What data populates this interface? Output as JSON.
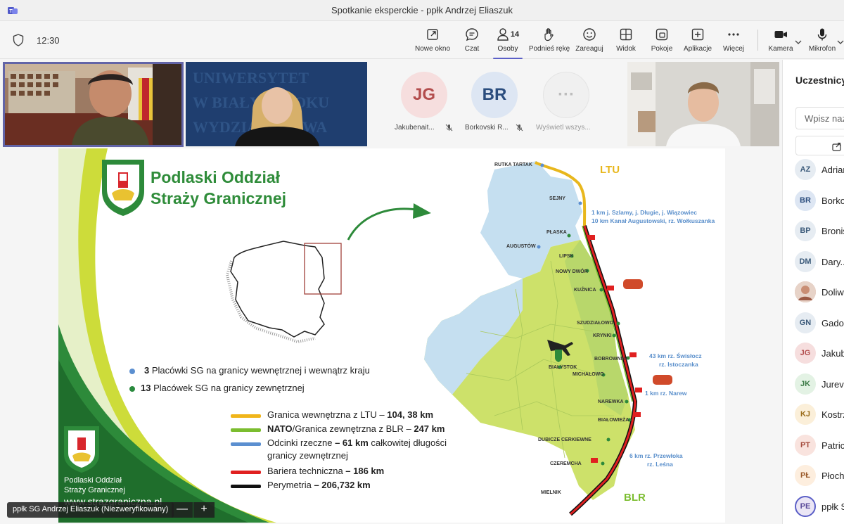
{
  "window": {
    "title": "Spotkanie eksperckie - ppłk Andrzej Eliaszuk"
  },
  "toolbar": {
    "time": "12:30",
    "buttons": [
      {
        "label": "Nowe okno",
        "icon": "pop-out-icon"
      },
      {
        "label": "Czat",
        "icon": "chat-icon"
      },
      {
        "label": "Osoby",
        "icon": "people-icon",
        "count": "14",
        "active": true
      },
      {
        "label": "Podnieś rękę",
        "icon": "raise-hand-icon"
      },
      {
        "label": "Zareaguj",
        "icon": "smiley-icon"
      },
      {
        "label": "Widok",
        "icon": "grid-view-icon"
      },
      {
        "label": "Pokoje",
        "icon": "breakout-rooms-icon"
      },
      {
        "label": "Aplikacje",
        "icon": "add-apps-icon"
      },
      {
        "label": "Więcej",
        "icon": "more-icon"
      },
      {
        "label": "Kamera",
        "icon": "camera-icon"
      },
      {
        "label": "Mikrofon",
        "icon": "microphone-icon"
      }
    ]
  },
  "participants_strip": [
    {
      "initials": "JG",
      "name": "Jakubenait...",
      "bg": "#f6dede",
      "fg": "#b34d4d",
      "muted": true
    },
    {
      "initials": "BR",
      "name": "Borkovski R...",
      "bg": "#dde6f3",
      "fg": "#2b4d7e",
      "muted": true
    },
    {
      "initials": "···",
      "name": "Wyświetl wszys...",
      "bg": "#f0f0f0",
      "fg": "#bdbdbd",
      "muted": false
    }
  ],
  "slide": {
    "title_line1": "Podlaski Oddział",
    "title_line2": "Straży Granicznej",
    "bullets": [
      {
        "num": "3",
        "text": "Placówki SG na granicy wewnętrznej i wewnątrz kraju",
        "color": "#5b8fd0"
      },
      {
        "num": "13",
        "text": "Placówek SG na granicy zewnętrznej",
        "color": "#2a8a3e"
      }
    ],
    "legend": [
      {
        "pre": "Granica wewnętrzna z LTU – ",
        "bold": "104, 38 km",
        "post": "",
        "color": "#f0b51a"
      },
      {
        "pre": "",
        "bold": "NATO",
        "post": "/Granica zewnętrzna z BLR – ",
        "bold2": "247 km",
        "color": "#7bbd2f"
      },
      {
        "pre": "Odcinki rzeczne ",
        "bold": "– 61 km",
        "post": " całkowitej długości",
        "line2": "granicy zewnętrznej",
        "color": "#5b8fd0"
      },
      {
        "pre": "Bariera techniczna ",
        "bold": "– 186 km",
        "post": "",
        "color": "#e02020"
      },
      {
        "pre": "Perymetria ",
        "bold": "– 206,732 km",
        "post": "",
        "color": "#111111"
      }
    ],
    "footer_org_line1": "Podlaski Oddział",
    "footer_org_line2": "Straży Granicznej",
    "footer_url": "www.strazgraniczna.pl",
    "map": {
      "country_ltu": "LTU",
      "country_blr": "BLR",
      "places": [
        "RUTKA TARTAK",
        "SEJNY",
        "PŁASKA",
        "AUGUSTÓW",
        "LIPSK",
        "NOWY DWÓR",
        "KUŹNICA",
        "SZUDZIAŁOWO",
        "KRYNKI",
        "BOBROWNIKI",
        "BIAŁYSTOK",
        "MICHAŁOWO",
        "NAREWKA",
        "BIAŁOWIEŻA",
        "DUBICZE CERKIEWNE",
        "CZEREMCHA",
        "MIELNIK"
      ],
      "notes": [
        {
          "line1": "1 km j. Szlamy, j. Długie, j. Wiązowiec",
          "line2": "10 km Kanał Augustowski, rz. Wołkuszanka"
        },
        {
          "line1": "43 km rz. Świsłocz",
          "line2": "rz. Istoczanka"
        },
        {
          "line1": "1 km rz. Narew",
          "line2": ""
        },
        {
          "line1": "6 km rz. Przewłoka",
          "line2": "rz. Leśna"
        }
      ]
    }
  },
  "presenter": {
    "name": "ppłk SG Andrzej Eliaszuk (Niezweryfikowany)",
    "zoom_out": "—",
    "zoom_in": "+"
  },
  "panel": {
    "title": "Uczestnicy",
    "search_placeholder": "Wpisz nazwę",
    "people": [
      {
        "initials": "AZ",
        "name": "Adrian",
        "bg": "#e6ecf2",
        "fg": "#3b5a7a"
      },
      {
        "initials": "BR",
        "name": "Borkowski",
        "bg": "#dde6f3",
        "fg": "#2b4d7e"
      },
      {
        "initials": "BP",
        "name": "Bronisław",
        "bg": "#e6ecf2",
        "fg": "#3b5a7a"
      },
      {
        "initials": "DM",
        "name": "Dary...",
        "bg": "#e6ecf2",
        "fg": "#3b5a7a"
      },
      {
        "initials": "",
        "name": "Doliwa",
        "bg": "#d9a796",
        "fg": "#ffffff",
        "photo": true
      },
      {
        "initials": "GN",
        "name": "Gadomska",
        "bg": "#e6ecf2",
        "fg": "#3b5a7a"
      },
      {
        "initials": "JG",
        "name": "Jakubenaite",
        "bg": "#f6dede",
        "fg": "#b34d4d"
      },
      {
        "initials": "JK",
        "name": "Jurevičius",
        "bg": "#e3f2e4",
        "fg": "#3b7a46"
      },
      {
        "initials": "KJ",
        "name": "Kostrzewa",
        "bg": "#fbefd9",
        "fg": "#9a6c1a"
      },
      {
        "initials": "PT",
        "name": "Patric...",
        "bg": "#f9e3de",
        "fg": "#a54d3f"
      },
      {
        "initials": "PŁ",
        "name": "Płochocki",
        "bg": "#fdeede",
        "fg": "#9a5a2a"
      },
      {
        "initials": "PE",
        "name": "ppłk SG",
        "bg": "#ebe6f5",
        "fg": "#5b4b9a"
      }
    ]
  }
}
